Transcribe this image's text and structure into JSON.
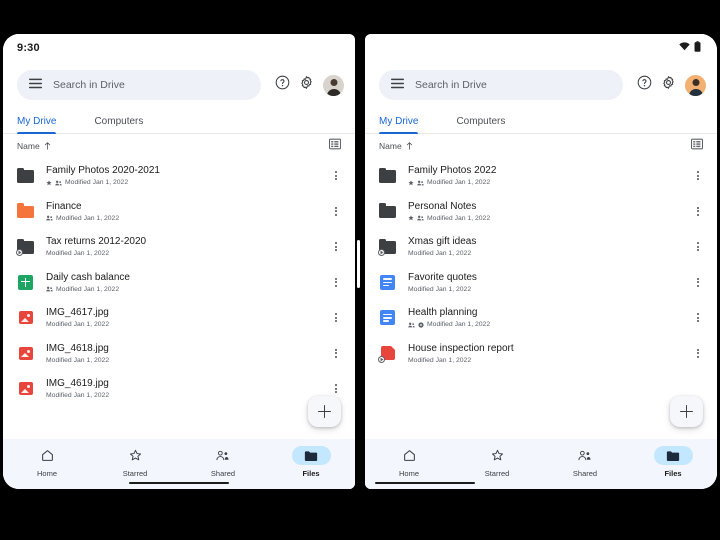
{
  "screens": [
    {
      "id": "left",
      "statusbar": {
        "clock": "9:30",
        "icons": []
      },
      "search": {
        "placeholder": "Search in Drive",
        "menu_icon": "hamburger-menu-icon"
      },
      "actions": {
        "help_icon": "help-circle-icon",
        "settings_icon": "gear-icon",
        "avatar_icon": "account-avatar"
      },
      "tabs": [
        {
          "label": "My Drive",
          "active": true
        },
        {
          "label": "Computers",
          "active": false
        }
      ],
      "sort": {
        "label": "Name",
        "direction_icon": "arrow-up-icon",
        "view_toggle_icon": "list-view-icon"
      },
      "files": [
        {
          "name": "Family Photos 2020-2021",
          "meta": "Modified Jan 1, 2022",
          "icon": "folder-dark",
          "starred": true,
          "shared": true,
          "locked": false
        },
        {
          "name": "Finance",
          "meta": "Modified Jan 1, 2022",
          "icon": "folder-orange",
          "starred": false,
          "shared": true,
          "locked": false
        },
        {
          "name": "Tax returns 2012-2020",
          "meta": "Modified Jan 1, 2022",
          "icon": "folder-shortcut",
          "starred": false,
          "shared": false,
          "locked": false
        },
        {
          "name": "Daily cash balance",
          "meta": "Modified Jan 1, 2022",
          "icon": "sheets",
          "starred": false,
          "shared": true,
          "locked": false
        },
        {
          "name": "IMG_4617.jpg",
          "meta": "Modified Jan 1, 2022",
          "icon": "image",
          "starred": false,
          "shared": false,
          "locked": false
        },
        {
          "name": "IMG_4618.jpg",
          "meta": "Modified Jan 1, 2022",
          "icon": "image",
          "starred": false,
          "shared": false,
          "locked": false
        },
        {
          "name": "IMG_4619.jpg",
          "meta": "Modified Jan 1, 2022",
          "icon": "image",
          "starred": false,
          "shared": false,
          "locked": false
        }
      ],
      "fab": {
        "icon": "plus-icon",
        "label": ""
      },
      "nav": [
        {
          "label": "Home",
          "icon": "home-icon",
          "active": false
        },
        {
          "label": "Starred",
          "icon": "star-icon",
          "active": false
        },
        {
          "label": "Shared",
          "icon": "people-icon",
          "active": false
        },
        {
          "label": "Files",
          "icon": "folder-icon",
          "active": true
        }
      ]
    },
    {
      "id": "right",
      "statusbar": {
        "clock": "",
        "icons": [
          "wifi-icon",
          "battery-icon"
        ]
      },
      "search": {
        "placeholder": "Search in Drive",
        "menu_icon": "hamburger-menu-icon"
      },
      "actions": {
        "help_icon": "help-circle-icon",
        "settings_icon": "gear-icon",
        "avatar_icon": "account-avatar"
      },
      "tabs": [
        {
          "label": "My Drive",
          "active": true
        },
        {
          "label": "Computers",
          "active": false
        }
      ],
      "sort": {
        "label": "Name",
        "direction_icon": "arrow-up-icon",
        "view_toggle_icon": "list-view-icon"
      },
      "files": [
        {
          "name": "Family Photos 2022",
          "meta": "Modified Jan 1, 2022",
          "icon": "folder-dark",
          "starred": true,
          "shared": true,
          "locked": false
        },
        {
          "name": "Personal Notes",
          "meta": "Modified Jan 1, 2022",
          "icon": "folder-dark",
          "starred": true,
          "shared": true,
          "locked": false
        },
        {
          "name": "Xmas gift ideas",
          "meta": "Modified Jan 1, 2022",
          "icon": "folder-shortcut",
          "starred": false,
          "shared": false,
          "locked": false
        },
        {
          "name": "Favorite quotes",
          "meta": "Modified Jan 1, 2022",
          "icon": "docs",
          "starred": false,
          "shared": false,
          "locked": false
        },
        {
          "name": "Health planning",
          "meta": "Modified Jan 1, 2022",
          "icon": "docs",
          "starred": false,
          "shared": true,
          "locked": true
        },
        {
          "name": "House inspection report",
          "meta": "Modified Jan 1, 2022",
          "icon": "pdf",
          "starred": false,
          "shared": false,
          "locked": false
        }
      ],
      "fab": {
        "icon": "plus-icon",
        "label": ""
      },
      "nav": [
        {
          "label": "Home",
          "icon": "home-icon",
          "active": false
        },
        {
          "label": "Starred",
          "icon": "star-icon",
          "active": false
        },
        {
          "label": "Shared",
          "icon": "people-icon",
          "active": false
        },
        {
          "label": "Files",
          "icon": "folder-icon",
          "active": true
        }
      ]
    }
  ],
  "colors": {
    "accent": "#1967d2",
    "nav_active_pill": "#c2e7ff",
    "search_bg": "#eef1f8",
    "folder_dark": "#3c4043",
    "folder_orange": "#f4743b",
    "sheets_green": "#1ea463",
    "docs_blue": "#4285f4",
    "red": "#e8453c",
    "bottom_nav_bg": "#f3f6fc"
  }
}
